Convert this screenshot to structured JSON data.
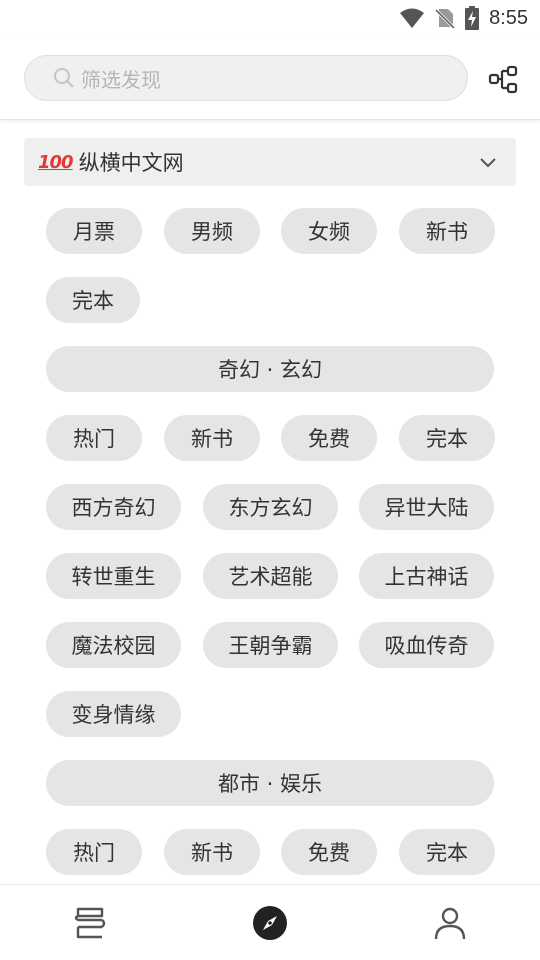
{
  "status_bar": {
    "time": "8:55"
  },
  "search": {
    "placeholder": "筛选发现"
  },
  "source": {
    "badge": "100",
    "name": "纵横中文网"
  },
  "sections": {
    "top_chips": [
      "月票",
      "男频",
      "女频",
      "新书",
      "完本"
    ],
    "fantasy": {
      "title": "奇幻 · 玄幻",
      "chips": [
        "热门",
        "新书",
        "免费",
        "完本"
      ],
      "genres": [
        "西方奇幻",
        "东方玄幻",
        "异世大陆",
        "转世重生",
        "艺术超能",
        "上古神话",
        "魔法校园",
        "王朝争霸",
        "吸血传奇",
        "变身情缘"
      ]
    },
    "urban": {
      "title": "都市 · 娱乐",
      "chips": [
        "热门",
        "新书",
        "免费",
        "完本"
      ]
    }
  },
  "bottom_nav": {
    "items": [
      "bookshelf-icon",
      "discover-icon",
      "profile-icon"
    ],
    "active": "discover-icon"
  }
}
